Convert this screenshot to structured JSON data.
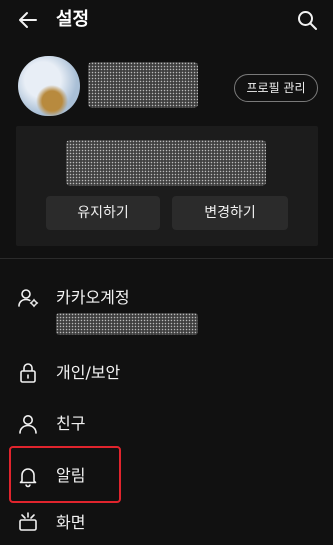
{
  "header": {
    "title": "설정"
  },
  "profile": {
    "manage_label": "프로필 관리"
  },
  "card": {
    "keep_label": "유지하기",
    "change_label": "변경하기"
  },
  "menu": {
    "items": [
      {
        "label": "카카오계정",
        "icon": "account-icon"
      },
      {
        "label": "개인/보안",
        "icon": "lock-icon"
      },
      {
        "label": "친구",
        "icon": "person-icon"
      },
      {
        "label": "알림",
        "icon": "bell-icon"
      },
      {
        "label": "화면",
        "icon": "display-icon"
      }
    ]
  },
  "colors": {
    "background": "#111111",
    "highlight": "#e0242d",
    "card": "#1c1c1c"
  }
}
